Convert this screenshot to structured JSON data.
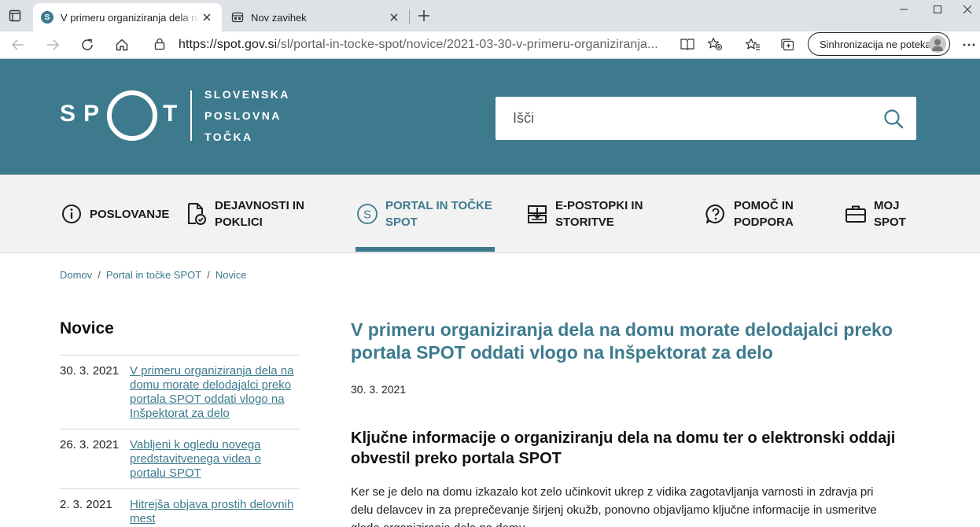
{
  "browser": {
    "tabs": [
      {
        "title": "V primeru organiziranja dela na d",
        "favicon": "S"
      },
      {
        "title": "Nov zavihek"
      }
    ],
    "url_host": "https://spot.gov.si",
    "url_path": "/sl/portal-in-tocke-spot/novice/2021-03-30-v-primeru-organiziranja...",
    "sync_label": "Sinhronizacija ne poteka"
  },
  "header": {
    "logo_letters": [
      "S",
      "P",
      "T"
    ],
    "logo_lines": [
      "SLOVENSKA",
      "POSLOVNA",
      "TOČKA"
    ],
    "search_placeholder": "Išči"
  },
  "nav": {
    "items": [
      {
        "line1": "POSLOVANJE",
        "line2": "",
        "icon": "info-circle-icon"
      },
      {
        "line1": "DEJAVNOSTI IN",
        "line2": "POKLICI",
        "icon": "document-check-icon"
      },
      {
        "line1": "PORTAL IN TOČKE",
        "line2": "SPOT",
        "icon": "spot-s-icon",
        "active": true
      },
      {
        "line1": "E-POSTOPKI IN",
        "line2": "STORITVE",
        "icon": "tray-download-icon"
      },
      {
        "line1": "POMOČ IN",
        "line2": "PODPORA",
        "icon": "help-bubble-icon"
      },
      {
        "line1": "MOJ",
        "line2": "SPOT",
        "icon": "briefcase-icon"
      }
    ]
  },
  "breadcrumb": [
    "Domov",
    "Portal in točke SPOT",
    "Novice"
  ],
  "sidebar": {
    "title": "Novice",
    "items": [
      {
        "date": "30. 3. 2021",
        "title": "V primeru organiziranja dela na domu morate delodajalci preko portala SPOT oddati vlogo na Inšpektorat za delo"
      },
      {
        "date": "26. 3. 2021",
        "title": "Vabljeni k ogledu novega predstavitvenega videa o portalu SPOT"
      },
      {
        "date": "2. 3. 2021",
        "title": "Hitrejša objava prostih delovnih mest"
      }
    ]
  },
  "article": {
    "title": "V primeru organiziranja dela na domu morate delodajalci preko portala SPOT oddati vlogo na Inšpektorat za delo",
    "date": "30. 3. 2021",
    "subtitle": "Ključne informacije o organiziranju dela na domu ter o elektronski oddaji obvestil preko portala SPOT",
    "body": "Ker se je delo na domu izkazalo kot zelo učinkovit ukrep z vidika zagotavljanja varnosti in zdravja pri delu delavcev in za preprečevanje širjenj okužb, ponovno objavljamo ključne informacije in usmeritve glede organiziranja dela na domu."
  },
  "colors": {
    "brand": "#3d7a8e",
    "nav_bg": "#f2f2f2"
  }
}
